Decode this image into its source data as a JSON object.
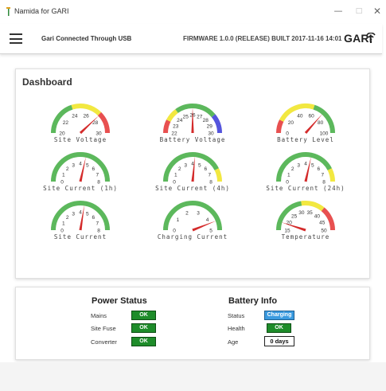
{
  "window": {
    "title": "Namida for GARI",
    "controls": {
      "minimize": "—",
      "maximize": "□",
      "close": "✕"
    }
  },
  "header": {
    "menu_icon": "hamburger-menu-icon",
    "connection_status": "Gari Connected Through USB",
    "firmware": "FIRMWARE 1.0.0 (RELEASE) BUILT 2017-11-16 14:01",
    "logo": "GARI",
    "logo_icon": "signal-waves-icon"
  },
  "dashboard": {
    "title": "Dashboard",
    "gauges": [
      {
        "label": "Site Voltage",
        "ticks": [
          "20",
          "22",
          "24",
          "26",
          "28",
          "30"
        ],
        "zones": [
          [
            "#5cb85c",
            0,
            0.4
          ],
          [
            "#f2e840",
            0.4,
            0.75
          ],
          [
            "#e85050",
            0.75,
            1
          ]
        ],
        "value_fraction": 0.76
      },
      {
        "label": "Battery Voltage",
        "ticks": [
          "22",
          "23",
          "24",
          "25",
          "26",
          "27",
          "28",
          "29",
          "30"
        ],
        "zones": [
          [
            "#e85050",
            0,
            0.15
          ],
          [
            "#f2e840",
            0.15,
            0.3
          ],
          [
            "#5cb85c",
            0.3,
            0.78
          ],
          [
            "#5555dd",
            0.78,
            1
          ]
        ],
        "value_fraction": 0.5
      },
      {
        "label": "Battery Level",
        "ticks": [
          "0",
          "20",
          "40",
          "60",
          "80",
          "100"
        ],
        "zones": [
          [
            "#e85050",
            0,
            0.15
          ],
          [
            "#f2e840",
            0.15,
            0.6
          ],
          [
            "#5cb85c",
            0.6,
            1
          ]
        ],
        "value_fraction": 0.73
      },
      {
        "label": "Site Current (1h)",
        "ticks": [
          "0",
          "1",
          "2",
          "3",
          "4",
          "5",
          "6",
          "7",
          "8"
        ],
        "zones": [
          [
            "#5cb85c",
            0,
            1
          ]
        ],
        "value_fraction": 0.57
      },
      {
        "label": "Site Current (4h)",
        "ticks": [
          "0",
          "1",
          "2",
          "3",
          "4",
          "5",
          "6",
          "7",
          "8"
        ],
        "zones": [
          [
            "#5cb85c",
            0,
            0.85
          ],
          [
            "#f2e840",
            0.85,
            1
          ]
        ],
        "value_fraction": 0.53
      },
      {
        "label": "Site Current (24h)",
        "ticks": [
          "0",
          "1",
          "2",
          "3",
          "4",
          "5",
          "6",
          "7",
          "8"
        ],
        "zones": [
          [
            "#5cb85c",
            0,
            0.85
          ],
          [
            "#f2e840",
            0.85,
            1
          ]
        ],
        "value_fraction": 0.57
      },
      {
        "label": "Site Current",
        "ticks": [
          "0",
          "1",
          "2",
          "3",
          "4",
          "5",
          "6",
          "7",
          "8"
        ],
        "zones": [
          [
            "#5cb85c",
            0,
            1
          ]
        ],
        "value_fraction": 0.55
      },
      {
        "label": "Charging Current",
        "ticks": [
          "0",
          "1",
          "2",
          "3",
          "4",
          "5"
        ],
        "zones": [
          [
            "#5cb85c",
            0,
            1
          ]
        ],
        "value_fraction": 0.88
      },
      {
        "label": "Temperature",
        "ticks": [
          "15",
          "20",
          "25",
          "30",
          "35",
          "40",
          "45",
          "50"
        ],
        "zones": [
          [
            "#5cb85c",
            0,
            0.45
          ],
          [
            "#f2e840",
            0.45,
            0.72
          ],
          [
            "#e85050",
            0.72,
            1
          ]
        ],
        "value_fraction": 0.1
      }
    ]
  },
  "power_status": {
    "title": "Power Status",
    "rows": [
      {
        "label": "Mains",
        "value": "OK"
      },
      {
        "label": "Site Fuse",
        "value": "OK"
      },
      {
        "label": "Converter",
        "value": "OK"
      }
    ]
  },
  "battery_info": {
    "title": "Battery Info",
    "rows": [
      {
        "label": "Status",
        "value": "Charging"
      },
      {
        "label": "Health",
        "value": "OK"
      },
      {
        "label": "Age",
        "value": "0 days"
      }
    ]
  },
  "colors": {
    "ok_green": "#1e8c2a",
    "charging_blue": "#3b9be0",
    "needle_red": "#d42b2b"
  }
}
